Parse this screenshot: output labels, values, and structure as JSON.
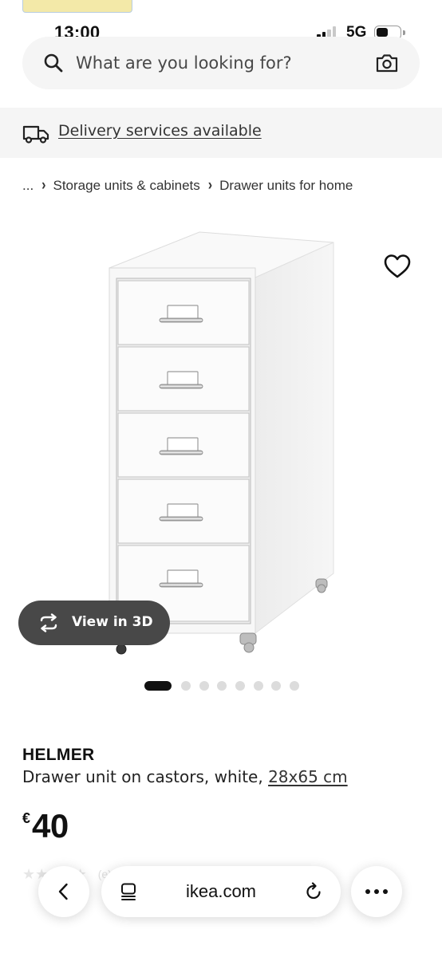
{
  "status_bar": {
    "time": "13:00",
    "network": "5G"
  },
  "search": {
    "placeholder": "What are you looking for?"
  },
  "delivery_banner": {
    "text": "Delivery services available"
  },
  "breadcrumb": {
    "ellipsis": "...",
    "items": [
      "Storage units & cabinets",
      "Drawer units for home"
    ]
  },
  "gallery": {
    "view_3d_label": "View in 3D",
    "image_count": 8,
    "active_index": 0
  },
  "product": {
    "name": "HELMER",
    "description": "Drawer unit on castors, white,",
    "size": "28x65 cm",
    "currency": "€",
    "price": "40",
    "rating_count": "(e)"
  },
  "browser": {
    "url": "ikea.com"
  },
  "icons": {
    "search": "search-icon",
    "camera": "camera-icon",
    "delivery": "truck-icon",
    "favorite": "heart-icon",
    "view_3d": "rotate-3d-icon",
    "back": "chevron-left-icon",
    "reader": "reader-mode-icon",
    "reload": "reload-icon",
    "more": "more-icon"
  },
  "colors": {
    "text": "#111111",
    "surface": "#f5f5f5",
    "pill_dark": "#484848",
    "dot_inactive": "#dcdcdc"
  }
}
